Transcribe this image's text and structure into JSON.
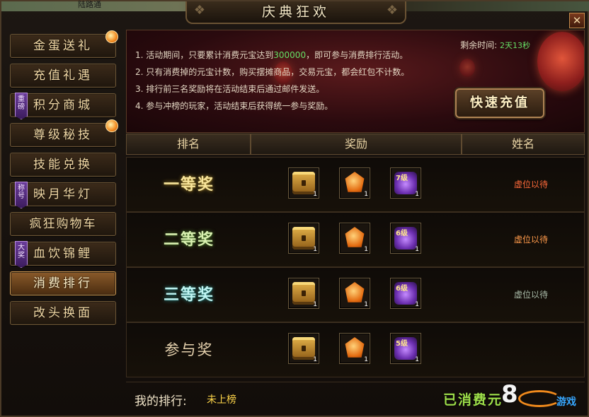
{
  "top_fragment": "陆路通",
  "window": {
    "title": "庆典狂欢",
    "close_label": "✕"
  },
  "sidebar": {
    "items": [
      {
        "label": "金蛋送礼",
        "badge": "gem"
      },
      {
        "label": "充值礼遇"
      },
      {
        "label": "积分商城",
        "tag": "重磅"
      },
      {
        "label": "尊级秘技",
        "badge": "gem"
      },
      {
        "label": "技能兑换"
      },
      {
        "label": "映月华灯",
        "tag": "称号"
      },
      {
        "label": "疯狂购物车"
      },
      {
        "label": "血饮锦鲤",
        "tag": "大奖"
      },
      {
        "label": "消费排行",
        "active": true
      },
      {
        "label": "改头换面"
      }
    ]
  },
  "banner": {
    "rules": [
      {
        "prefix": "1. 活动期间，只要累计消费元宝达到",
        "highlight": "300000",
        "suffix": "，即可参与消费排行活动。"
      },
      {
        "text": "2. 只有消费掉的元宝计数，购买摆摊商品，交易元宝，都会红包不计数。"
      },
      {
        "text": "3. 排行前三名奖励将在活动结束后通过邮件发送。"
      },
      {
        "text": "4. 参与冲榜的玩家，活动结束后获得统一参与奖励。"
      }
    ],
    "remain_label": "剩余时间:",
    "remain_value": "2天13秒",
    "recharge_button": "快速充值"
  },
  "table": {
    "headers": [
      "排名",
      "奖励",
      "姓名"
    ],
    "rows": [
      {
        "rank": "一等奖",
        "name": "虚位以待",
        "items": [
          {
            "icon": "chest-icon",
            "count": "1"
          },
          {
            "icon": "gem-icon",
            "count": "1"
          },
          {
            "icon": "purple-gift-icon",
            "count": "1",
            "level": "7级"
          }
        ]
      },
      {
        "rank": "二等奖",
        "name": "虚位以待",
        "items": [
          {
            "icon": "chest-icon",
            "count": "1"
          },
          {
            "icon": "gem-icon",
            "count": "1"
          },
          {
            "icon": "purple-gift-icon",
            "count": "1",
            "level": "6级"
          }
        ]
      },
      {
        "rank": "三等奖",
        "name": "虚位以待",
        "items": [
          {
            "icon": "chest-icon",
            "count": "1"
          },
          {
            "icon": "gem-icon",
            "count": "1"
          },
          {
            "icon": "purple-gift-icon",
            "count": "1",
            "level": "6级"
          }
        ]
      },
      {
        "rank": "参与奖",
        "name": "",
        "items": [
          {
            "icon": "chest-icon",
            "count": "1"
          },
          {
            "icon": "gem-icon",
            "count": "1"
          },
          {
            "icon": "purple-gift-icon",
            "count": "1",
            "level": "5级"
          }
        ]
      }
    ]
  },
  "footer": {
    "my_rank_label": "我的排行:",
    "my_rank_value": "未上榜",
    "spent_label": "已消费元"
  },
  "watermark": {
    "number": "8",
    "brand": "游戏"
  },
  "colors": {
    "accent": "#d59c52",
    "highlight_green": "#66e066",
    "rank_name_red": "#ff6a3a",
    "gold": "#ffd64a"
  }
}
